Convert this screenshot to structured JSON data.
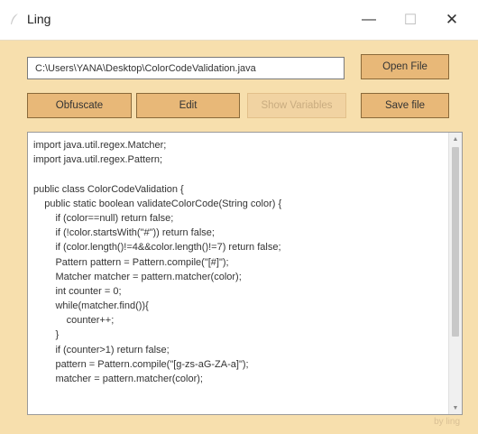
{
  "window": {
    "title": "Ling",
    "minimize_glyph": "—",
    "maximize_glyph": "☐",
    "close_glyph": "✕"
  },
  "file": {
    "path": "C:\\Users\\YANA\\Desktop\\ColorCodeValidation.java"
  },
  "toolbar": {
    "open_label": "Open File",
    "obfuscate_label": "Obfuscate",
    "edit_label": "Edit",
    "show_variables_label": "Show Variables",
    "save_label": "Save file"
  },
  "editor": {
    "lines": [
      "import java.util.regex.Matcher;",
      "import java.util.regex.Pattern;",
      "",
      "public class ColorCodeValidation {",
      "    public static boolean validateColorCode(String color) {",
      "        if (color==null) return false;",
      "        if (!color.startsWith(\"#\")) return false;",
      "        if (color.length()!=4&&color.length()!=7) return false;",
      "        Pattern pattern = Pattern.compile(\"[#]\");",
      "        Matcher matcher = pattern.matcher(color);",
      "        int counter = 0;",
      "        while(matcher.find()){",
      "            counter++;",
      "        }",
      "        if (counter>1) return false;",
      "        pattern = Pattern.compile(\"[g-zs-aG-ZA-a]\");",
      "        matcher = pattern.matcher(color);"
    ]
  },
  "footer": {
    "credit": "by ling"
  },
  "colors": {
    "background": "#f7dfad",
    "button": "#e8b878",
    "button_disabled": "#f1d3a2"
  }
}
